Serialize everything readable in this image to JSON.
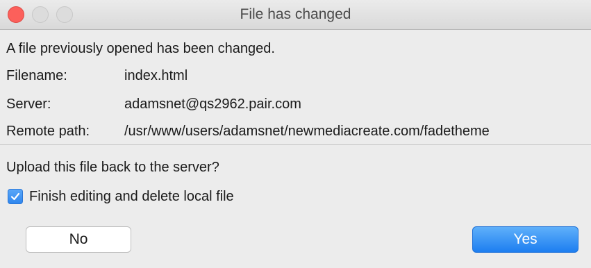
{
  "window": {
    "title": "File has changed"
  },
  "message": "A file previously opened has been changed.",
  "fields": {
    "filename": {
      "label": "Filename:",
      "value": "index.html"
    },
    "server": {
      "label": "Server:",
      "value": "adamsnet@qs2962.pair.com"
    },
    "remote_path": {
      "label": "Remote path:",
      "value": "/usr/www/users/adamsnet/newmediacreate.com/fadetheme"
    }
  },
  "question": "Upload this file back to the server?",
  "checkbox": {
    "label": "Finish editing and delete local file",
    "checked": true,
    "icon": "checkmark-icon"
  },
  "buttons": {
    "no_label": "No",
    "yes_label": "Yes"
  },
  "colors": {
    "accent": "#2f86ee",
    "close_button": "#fc605b",
    "window_background": "#ececec"
  }
}
